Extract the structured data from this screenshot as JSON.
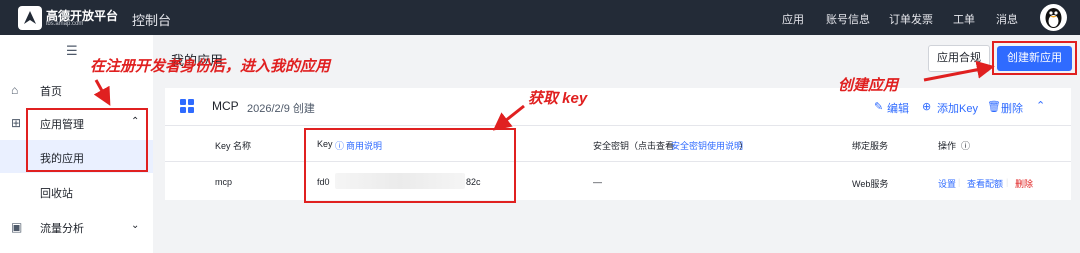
{
  "header": {
    "logo_name": "高德开放平台",
    "logo_sub": "lbs.amap.com",
    "console": "控制台",
    "nav": [
      "应用",
      "账号信息",
      "订单发票",
      "工单",
      "消息"
    ]
  },
  "sidebar": {
    "items": [
      {
        "label": "首页",
        "icon": "home-icon"
      },
      {
        "label": "应用管理",
        "icon": "grid-icon"
      },
      {
        "label": "我的应用"
      },
      {
        "label": "回收站"
      },
      {
        "label": "流量分析",
        "icon": "chart-icon"
      }
    ]
  },
  "main": {
    "title": "我的应用",
    "compliance_button": "应用合规",
    "create_button": "创建新应用"
  },
  "app_card": {
    "name": "MCP",
    "date": "2026/2/9 创建",
    "actions": {
      "edit": "编辑",
      "add_key": "添加Key",
      "delete": "删除"
    },
    "columns": {
      "key_name": "Key 名称",
      "key": "Key",
      "key_help": "商用说明",
      "secret_prefix": "安全密钥（点击查看",
      "secret_link": "安全密钥使用说明",
      "secret_suffix": "）",
      "service": "绑定服务",
      "ops": "操作"
    },
    "row": {
      "key_name": "mcp",
      "key_start": "fd0",
      "key_end": "82c",
      "secret": "—",
      "service": "Web服务",
      "ops": {
        "settings": "设置",
        "quota": "查看配额",
        "delete": "删除"
      }
    }
  },
  "annotations": {
    "after_register": "在注册开发者身份后，进入我的应用",
    "get_key": "获取 key",
    "create_app": "创建应用"
  },
  "colors": {
    "accent": "#2f6bff",
    "annotation": "#e02020",
    "header_bg": "#232b37"
  }
}
